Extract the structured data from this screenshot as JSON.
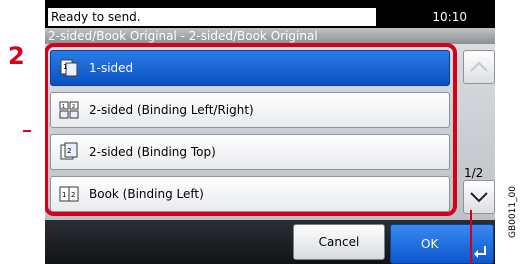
{
  "callout": {
    "step": "2"
  },
  "status": {
    "message": "Ready to send.",
    "time": "10:10"
  },
  "title": "2-sided/Book Original - 2-sided/Book Original",
  "options": [
    {
      "label": "1-sided",
      "icon": "one-sided-icon",
      "selected": true
    },
    {
      "label": "2-sided (Binding Left/Right)",
      "icon": "two-sided-left-right-icon",
      "selected": false
    },
    {
      "label": "2-sided (Binding Top)",
      "icon": "two-sided-top-icon",
      "selected": false
    },
    {
      "label": "Book (Binding Left)",
      "icon": "book-binding-left-icon",
      "selected": false
    }
  ],
  "pagination": {
    "page": "1/2"
  },
  "buttons": {
    "cancel": "Cancel",
    "ok": "OK"
  },
  "figure_code": "GB0011_00",
  "colors": {
    "callout_red": "#d6001c",
    "selected_blue": "#0b52c2"
  }
}
